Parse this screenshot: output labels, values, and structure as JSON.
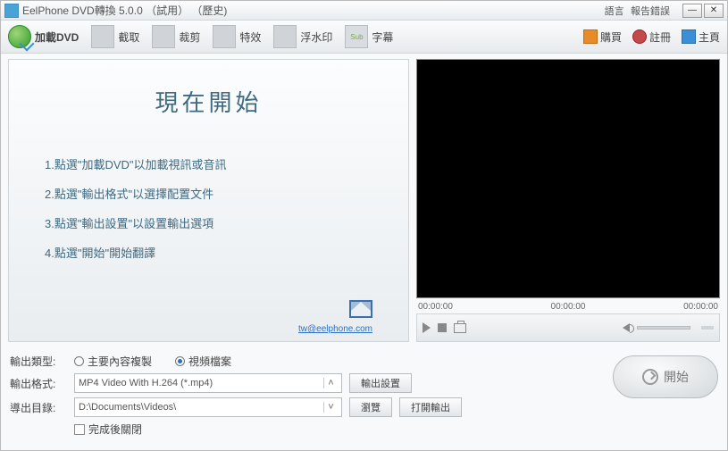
{
  "title": {
    "app": "EelPhone DVD轉換 5.0.0 （試用） （歷史)"
  },
  "title_links": {
    "lang": "語言",
    "report": "報告錯誤"
  },
  "toolbar": {
    "load": "加載DVD",
    "clip": "截取",
    "crop": "裁剪",
    "effect": "特效",
    "watermark": "浮水印",
    "subtitle": "字幕"
  },
  "rtools": {
    "buy": "購買",
    "register": "註冊",
    "home": "主頁"
  },
  "left": {
    "title": "現在開始",
    "step1": "1.點選\"加載DVD\"以加載視訊或音訊",
    "step2": "2.點選\"輸出格式\"以選擇配置文件",
    "step3": "3.點選\"輸出設置\"以設置輸出選項",
    "step4": "4.點選\"開始\"開始翻譯",
    "mail": "tw@eelphone.com"
  },
  "player": {
    "t1": "00:00:00",
    "t2": "00:00:00",
    "t3": "00:00:00"
  },
  "bottom": {
    "type_label": "輸出類型:",
    "radio1": "主要內容複製",
    "radio2": "視頻檔案",
    "format_label": "輸出格式:",
    "format_value": "MP4 Video With H.264 (*.mp4)",
    "settings_btn": "輸出設置",
    "dir_label": "導出目錄:",
    "dir_value": "D:\\Documents\\Videos\\",
    "browse_btn": "瀏覽",
    "open_btn": "打開輸出",
    "close_after": "完成後關閉",
    "start_btn": "開始"
  }
}
